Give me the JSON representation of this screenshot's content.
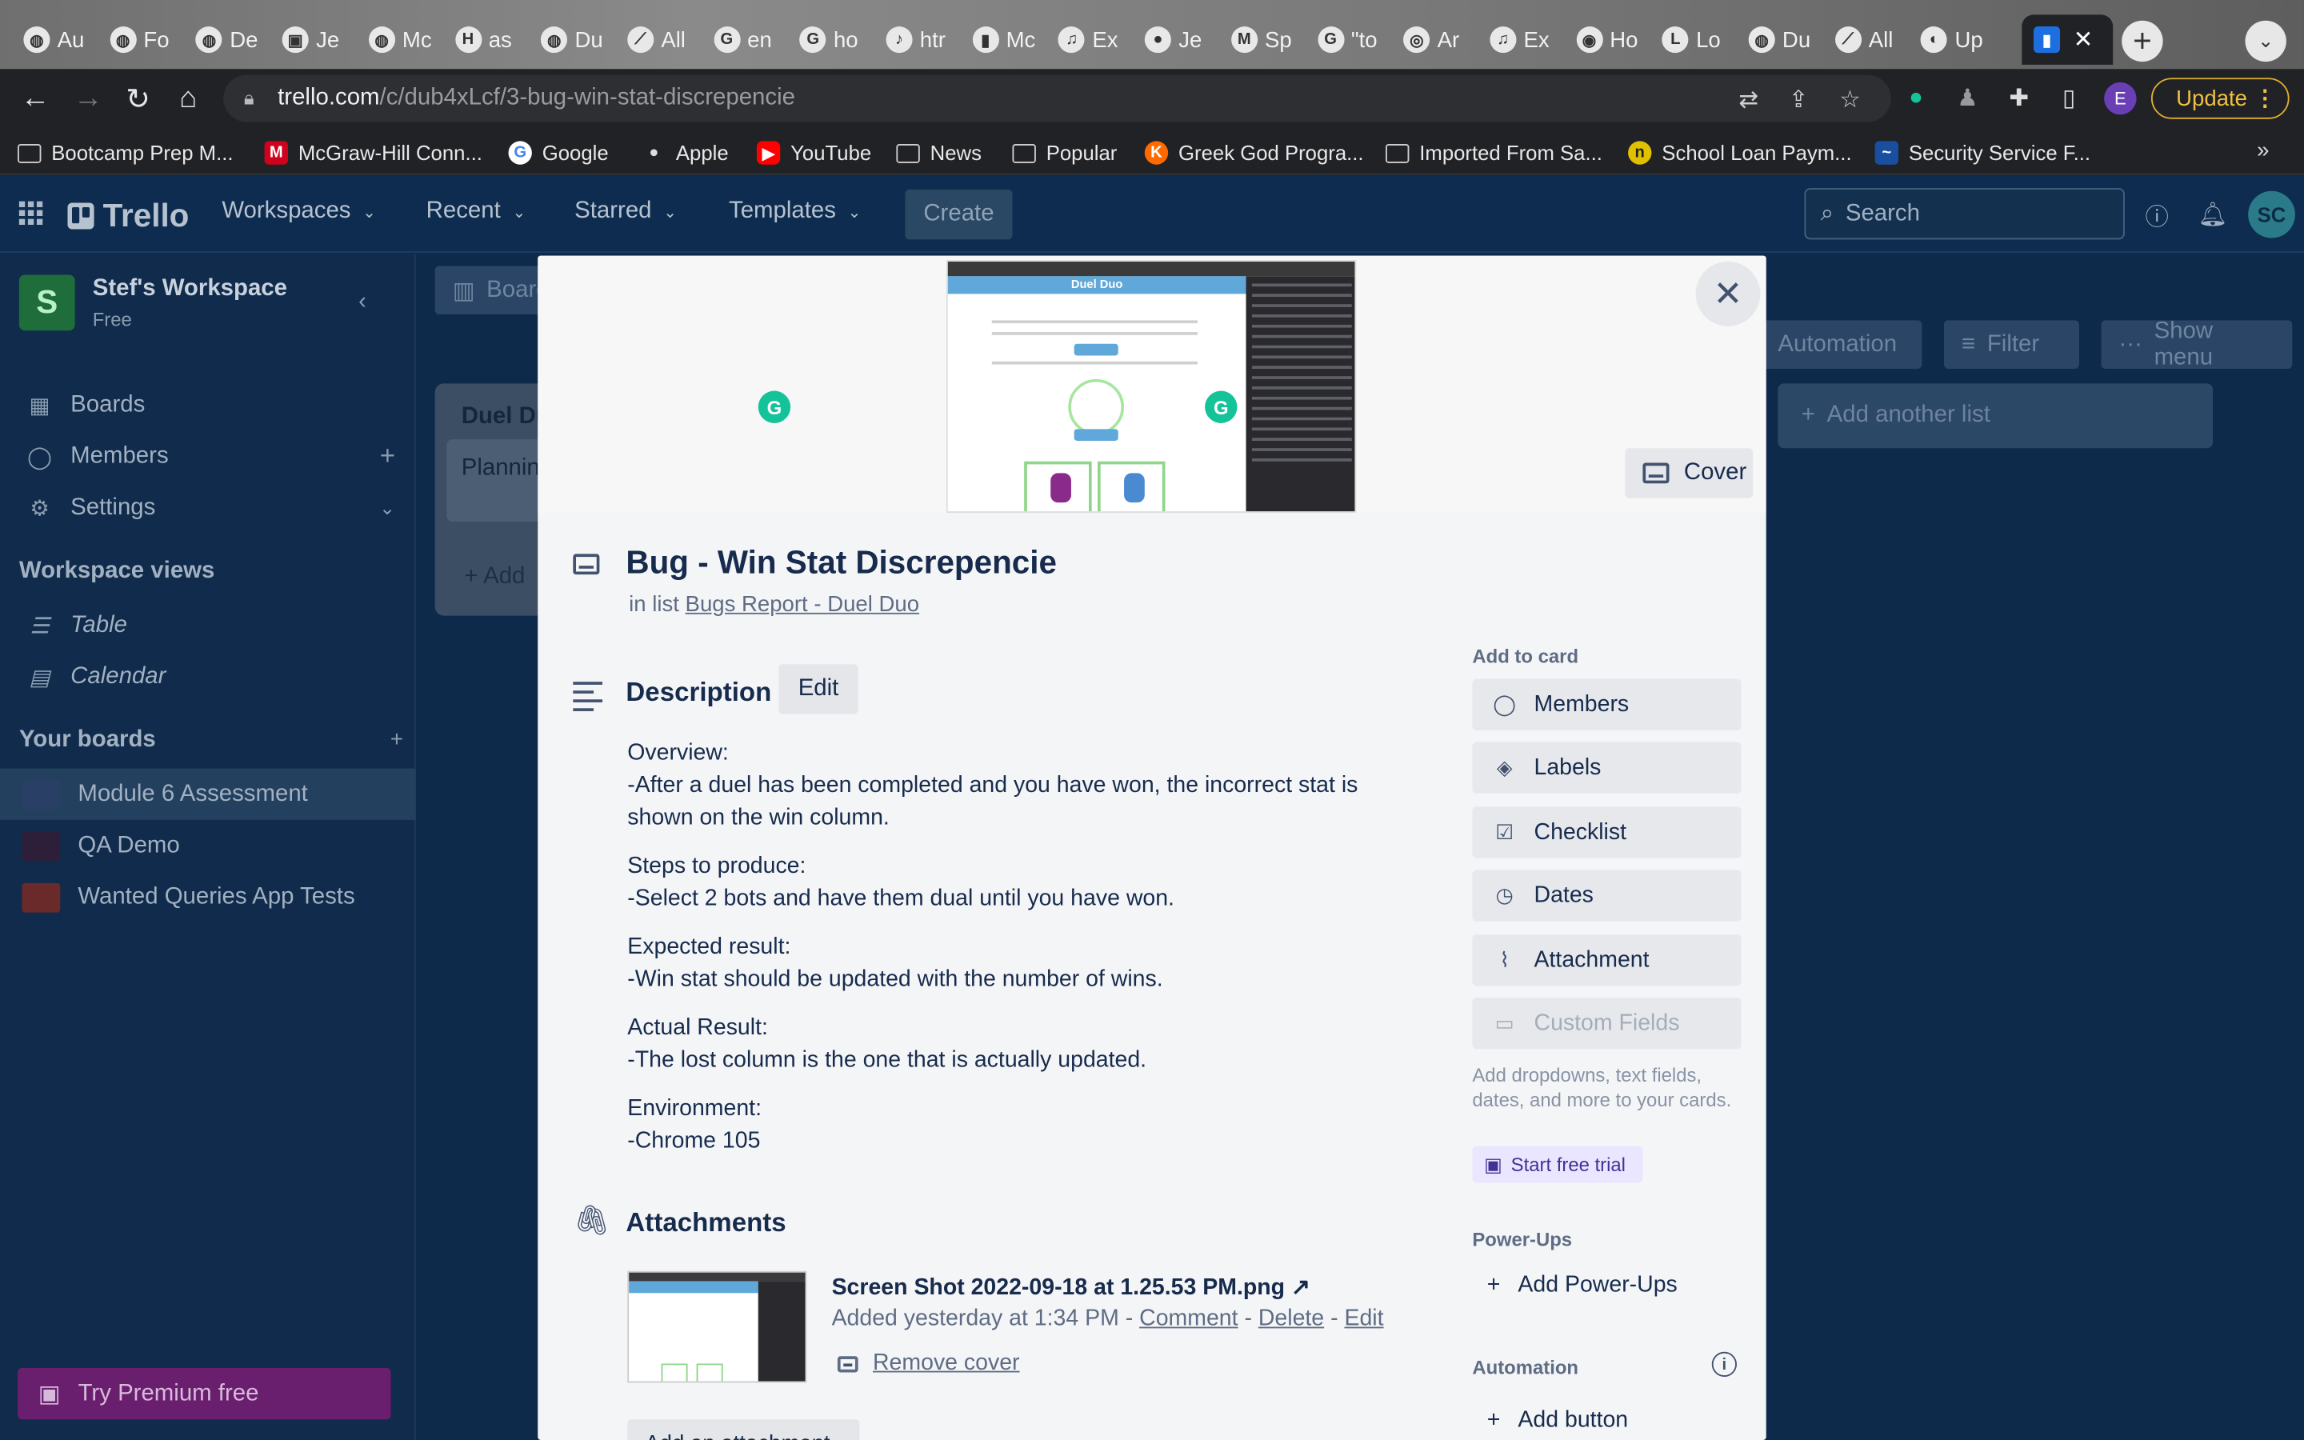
{
  "browser": {
    "tabs": [
      {
        "label": "Au"
      },
      {
        "label": "Fo"
      },
      {
        "label": "De"
      },
      {
        "label": "Je"
      },
      {
        "label": "Mc"
      },
      {
        "label": "as"
      },
      {
        "label": "Du"
      },
      {
        "label": "All"
      },
      {
        "label": "en"
      },
      {
        "label": "ho"
      },
      {
        "label": "htr"
      },
      {
        "label": "Mc"
      },
      {
        "label": "Ex"
      },
      {
        "label": "Je"
      },
      {
        "label": "Sp"
      },
      {
        "label": "\"to"
      },
      {
        "label": "Ar"
      },
      {
        "label": "Ex"
      },
      {
        "label": "Ho"
      },
      {
        "label": "Lo"
      },
      {
        "label": "Du"
      },
      {
        "label": "All"
      },
      {
        "label": "Up"
      }
    ],
    "url_host": "trello.com",
    "url_path": "/c/dub4xLcf/3-bug-win-stat-discrepencie",
    "profile_initial": "E",
    "update_label": "Update",
    "bookmarks": [
      "Bootcamp Prep M...",
      "McGraw-Hill Conn...",
      "Google",
      "Apple",
      "YouTube",
      "News",
      "Popular",
      "Greek God Progra...",
      "Imported From Sa...",
      "School Loan Paym...",
      "Security Service F..."
    ],
    "more_bookmarks": "»"
  },
  "header": {
    "brand": "Trello",
    "nav": [
      "Workspaces",
      "Recent",
      "Starred",
      "Templates"
    ],
    "create_label": "Create",
    "search_placeholder": "Search",
    "avatar_initials": "SC"
  },
  "sidebar": {
    "workspace_initial": "S",
    "workspace_name": "Stef's Workspace",
    "workspace_plan": "Free",
    "items": [
      "Boards",
      "Members",
      "Settings"
    ],
    "views_heading": "Workspace views",
    "views": [
      "Table",
      "Calendar"
    ],
    "boards_heading": "Your boards",
    "boards": [
      {
        "name": "Module 6 Assessment",
        "color": "#2a3f66"
      },
      {
        "name": "QA Demo",
        "color": "#2d1f3a"
      },
      {
        "name": "Wanted Queries App Tests",
        "color": "#6a2a2a"
      }
    ],
    "premium_label": "Try Premium free"
  },
  "board": {
    "view_button": "Board",
    "automation_label": "Automation",
    "filter_label": "Filter",
    "show_menu_label": "Show menu",
    "list_title": "Duel Du",
    "card_title": "Plannin",
    "add_card": "Add",
    "add_list": "Add another list"
  },
  "modal": {
    "cover_app_title": "Duel Duo",
    "cover_button": "Cover",
    "title": "Bug - Win Stat Discrepencie",
    "in_list_prefix": "in list",
    "list_name": "Bugs Report - Duel Duo",
    "description_heading": "Description",
    "edit_label": "Edit",
    "description": [
      {
        "heading": "Overview:",
        "text": "-After a duel has been completed and you have won, the incorrect stat is shown on the win column."
      },
      {
        "heading": "Steps to produce:",
        "text": "-Select 2 bots and have them dual until you have won."
      },
      {
        "heading": "Expected result:",
        "text": "-Win stat should be updated with the number of wins."
      },
      {
        "heading": "Actual Result:",
        "text": "-The lost column is the one that is actually updated."
      },
      {
        "heading": "Environment:",
        "text": "-Chrome 105"
      }
    ],
    "attachments_heading": "Attachments",
    "attachment": {
      "name": "Screen Shot 2022-09-18 at 1.25.53 PM.png",
      "external_icon": "↗",
      "added": "Added yesterday at 1:34 PM",
      "sep": " - ",
      "comment": "Comment",
      "delete": "Delete",
      "edit": "Edit",
      "remove_cover": "Remove cover"
    },
    "add_attachment": "Add an attachment",
    "side": {
      "add_heading": "Add to card",
      "buttons": [
        "Members",
        "Labels",
        "Checklist",
        "Dates",
        "Attachment",
        "Custom Fields"
      ],
      "custom_fields_note": "Add dropdowns, text fields, dates, and more to your cards.",
      "trial_label": "Start free trial",
      "powerups_heading": "Power-Ups",
      "add_powerups": "Add Power-Ups",
      "automation_heading": "Automation",
      "add_button": "Add button"
    }
  },
  "colors": {
    "header_bg": "#0e2c4f",
    "modal_bg": "#f4f5f7",
    "premium_bg": "#6a1f6e",
    "grammarly": "#15c39a"
  }
}
